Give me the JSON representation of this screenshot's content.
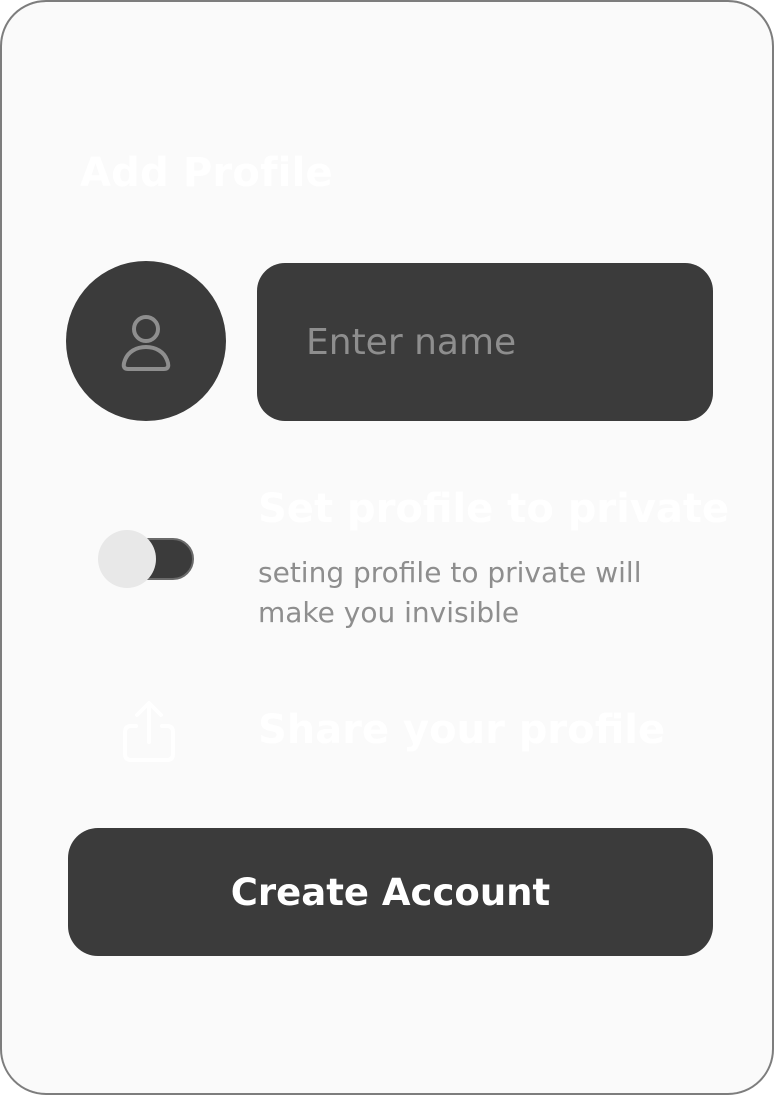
{
  "header": {
    "title": "Add Profile"
  },
  "profile": {
    "avatar_icon": "user-icon",
    "name_placeholder": "Enter name",
    "name_value": ""
  },
  "privacy": {
    "heading": "Set profile to private",
    "description": "seting profile to private will make you invisible",
    "toggle_state": "off"
  },
  "share": {
    "icon": "share-upload-icon",
    "label": "Share your profile"
  },
  "actions": {
    "create_label": "Create Account"
  },
  "colors": {
    "card_background": "#fafafa",
    "surface_dark": "#3b3b3b",
    "muted_text": "#8e8e8e",
    "border": "#7d7d7d",
    "knob": "#e8e8e8"
  }
}
